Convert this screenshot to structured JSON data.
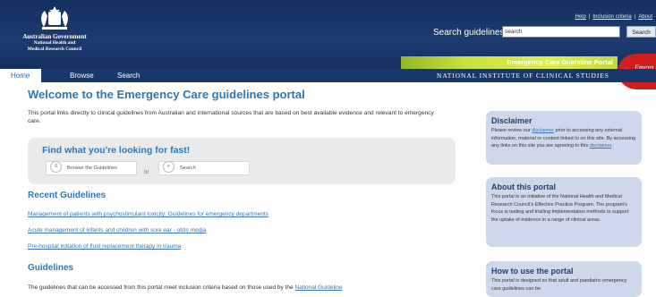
{
  "header": {
    "gov_name": "Australian Government",
    "council_line1": "National Health and",
    "council_line2": "Medical Research Council",
    "links": {
      "help": "Help",
      "inclusion": "Inclusion criteria",
      "about": "About"
    },
    "search_label": "Search guidelines:",
    "search_value": "search",
    "search_button": "Search",
    "portal_banner": "Emergency Care Guideline Portal",
    "portal_logo_text": "Emerg",
    "nice_text": "NATIONAL INSTITUTE OF CLINICAL STUDIES"
  },
  "nav": {
    "home": "Home",
    "browse": "Browse",
    "search": "Search"
  },
  "main": {
    "title": "Welcome to the Emergency Care guidelines portal",
    "intro": "This portal links directly to clinical guidelines from Australian and international sources that are based on best available evidence and relevant to emergency care.",
    "find": {
      "title": "Find what you're looking for fast!",
      "browse_label": "Browse the Guidelines",
      "or": "or",
      "search_label": "Search"
    },
    "recent_title": "Recent Guidelines",
    "recent": [
      "Management of patients with psychostimulant toxicity: Guidelines for emergency departments",
      "Acute management of infants and children with sore ear - otitis media",
      "Pre-hospital initiation of fluid replacement therapy in trauma"
    ],
    "guidelines_title": "Guidelines",
    "guidelines_text": "The guidelines that can be accessed from this portal meet inclusion criteria based on those used by the",
    "guidelines_link": "National Guideline"
  },
  "sidebar": {
    "disclaimer": {
      "title": "Disclaimer",
      "t1": "Please review our ",
      "link1": "disclaimer",
      "t2": " prior to accessing any external information, material or content linked to on this site. By accessing any links on this site you are agreeing to this ",
      "link2": "disclaimer",
      "t3": "."
    },
    "about": {
      "title": "About this portal",
      "text": "This portal is an initiative of the National Health and Medical Research Council's Effective Practice Program. The program's focus is testing and trialling implementation methods to support the uptake of evidence in a range of clinical areas."
    },
    "howto": {
      "title": "How to use the portal",
      "text": "This portal is designed so that adult and paediatric emergency care guidelines can be"
    }
  },
  "colors": {
    "header": "#16305f",
    "accent": "#2f78b4",
    "banner": "#c9e23c",
    "sidebar": "#cfd8ea"
  }
}
